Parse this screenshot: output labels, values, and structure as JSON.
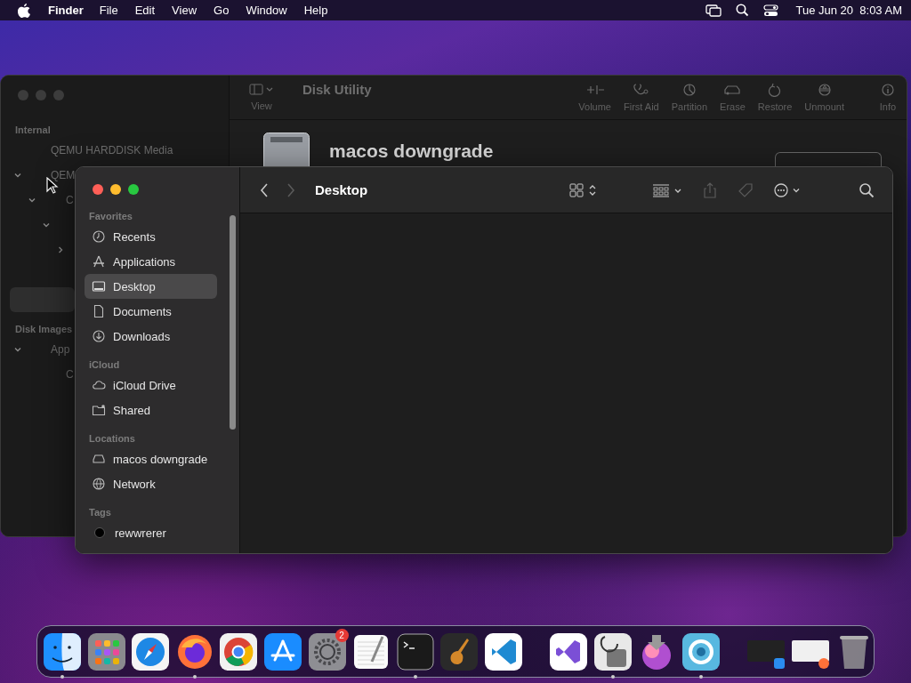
{
  "menu_bar": {
    "app_name": "Finder",
    "menus": [
      "File",
      "Edit",
      "View",
      "Go",
      "Window",
      "Help"
    ],
    "clock": "Tue Jun 20  8:03 AM"
  },
  "disk_utility": {
    "title": "Disk Utility",
    "view_label": "View",
    "toolbar": [
      {
        "kind": "volume",
        "label": "Volume"
      },
      {
        "kind": "first_aid",
        "label": "First Aid"
      },
      {
        "kind": "partition",
        "label": "Partition"
      },
      {
        "kind": "erase",
        "label": "Erase"
      },
      {
        "kind": "restore",
        "label": "Restore"
      },
      {
        "kind": "unmount",
        "label": "Unmount"
      },
      {
        "kind": "info",
        "label": "Info"
      }
    ],
    "sidebar": [
      {
        "heading": "Internal",
        "items": [
          {
            "label": "QEMU HARDDISK Media",
            "selected": false
          },
          {
            "label": "QEM",
            "expanded": true,
            "selected": false,
            "children": [
              {
                "label": "C",
                "expanded": true,
                "selected": false,
                "children": [
                  {
                    "expanded": true,
                    "children": [
                      {
                        "expanded": false
                      }
                    ]
                  }
                ]
              }
            ]
          },
          {
            "selected": true
          }
        ]
      },
      {
        "heading": "Disk Images",
        "items": [
          {
            "label": "App",
            "expanded": true,
            "selected": false,
            "children": [
              {
                "label": "C",
                "selected": false
              }
            ]
          }
        ]
      }
    ],
    "volume_name": "macos downgrade"
  },
  "finder": {
    "title": "Desktop",
    "nav": [
      {
        "kind": "back",
        "disabled": false
      },
      {
        "kind": "forward",
        "disabled": true
      }
    ],
    "tools": [
      {
        "kind": "icon_view",
        "disabled": false
      },
      {
        "kind": "group",
        "disabled": false
      },
      {
        "kind": "share",
        "disabled": true
      },
      {
        "kind": "tag",
        "disabled": true
      },
      {
        "kind": "more",
        "disabled": false
      },
      {
        "kind": "search",
        "disabled": false
      }
    ],
    "sidebar": [
      {
        "heading": "Favorites",
        "items": [
          {
            "kind": "clock",
            "label": "Recents",
            "selected": false
          },
          {
            "kind": "apps",
            "label": "Applications",
            "selected": false
          },
          {
            "kind": "desktop",
            "label": "Desktop",
            "selected": true
          },
          {
            "kind": "doc",
            "label": "Documents",
            "selected": false
          },
          {
            "kind": "download",
            "label": "Downloads",
            "selected": false
          }
        ]
      },
      {
        "heading": "iCloud",
        "items": [
          {
            "kind": "cloud",
            "label": "iCloud Drive",
            "selected": false
          },
          {
            "kind": "shared",
            "label": "Shared",
            "selected": false
          }
        ]
      },
      {
        "heading": "Locations",
        "items": [
          {
            "kind": "drive",
            "label": "macos downgrade",
            "selected": false
          },
          {
            "kind": "globe",
            "label": "Network",
            "selected": false
          }
        ]
      },
      {
        "heading": "Tags",
        "items": [
          {
            "kind": "tag",
            "label": "rewwrerer",
            "selected": false,
            "color": "#000000"
          }
        ]
      }
    ]
  },
  "dock": [
    {
      "kind": "finder",
      "running": true
    },
    {
      "kind": "launchpad",
      "running": false
    },
    {
      "kind": "safari",
      "running": false
    },
    {
      "kind": "firefox",
      "running": true
    },
    {
      "kind": "chrome",
      "running": false
    },
    {
      "kind": "appstore",
      "running": false
    },
    {
      "kind": "settings",
      "running": false,
      "badge": "2"
    },
    {
      "kind": "textedit",
      "running": false
    },
    {
      "kind": "terminal",
      "running": true
    },
    {
      "kind": "guitar",
      "running": false
    },
    {
      "kind": "vscode",
      "running": false
    },
    {
      "kind": "separator"
    },
    {
      "kind": "vstudio",
      "running": false
    },
    {
      "kind": "diskutil",
      "running": true
    },
    {
      "kind": "installer",
      "running": false
    },
    {
      "kind": "ring",
      "running": true
    },
    {
      "kind": "separator"
    },
    {
      "kind": "window_thumb",
      "running": false
    },
    {
      "kind": "window_thumb2",
      "running": false
    },
    {
      "kind": "trash",
      "running": false
    }
  ]
}
